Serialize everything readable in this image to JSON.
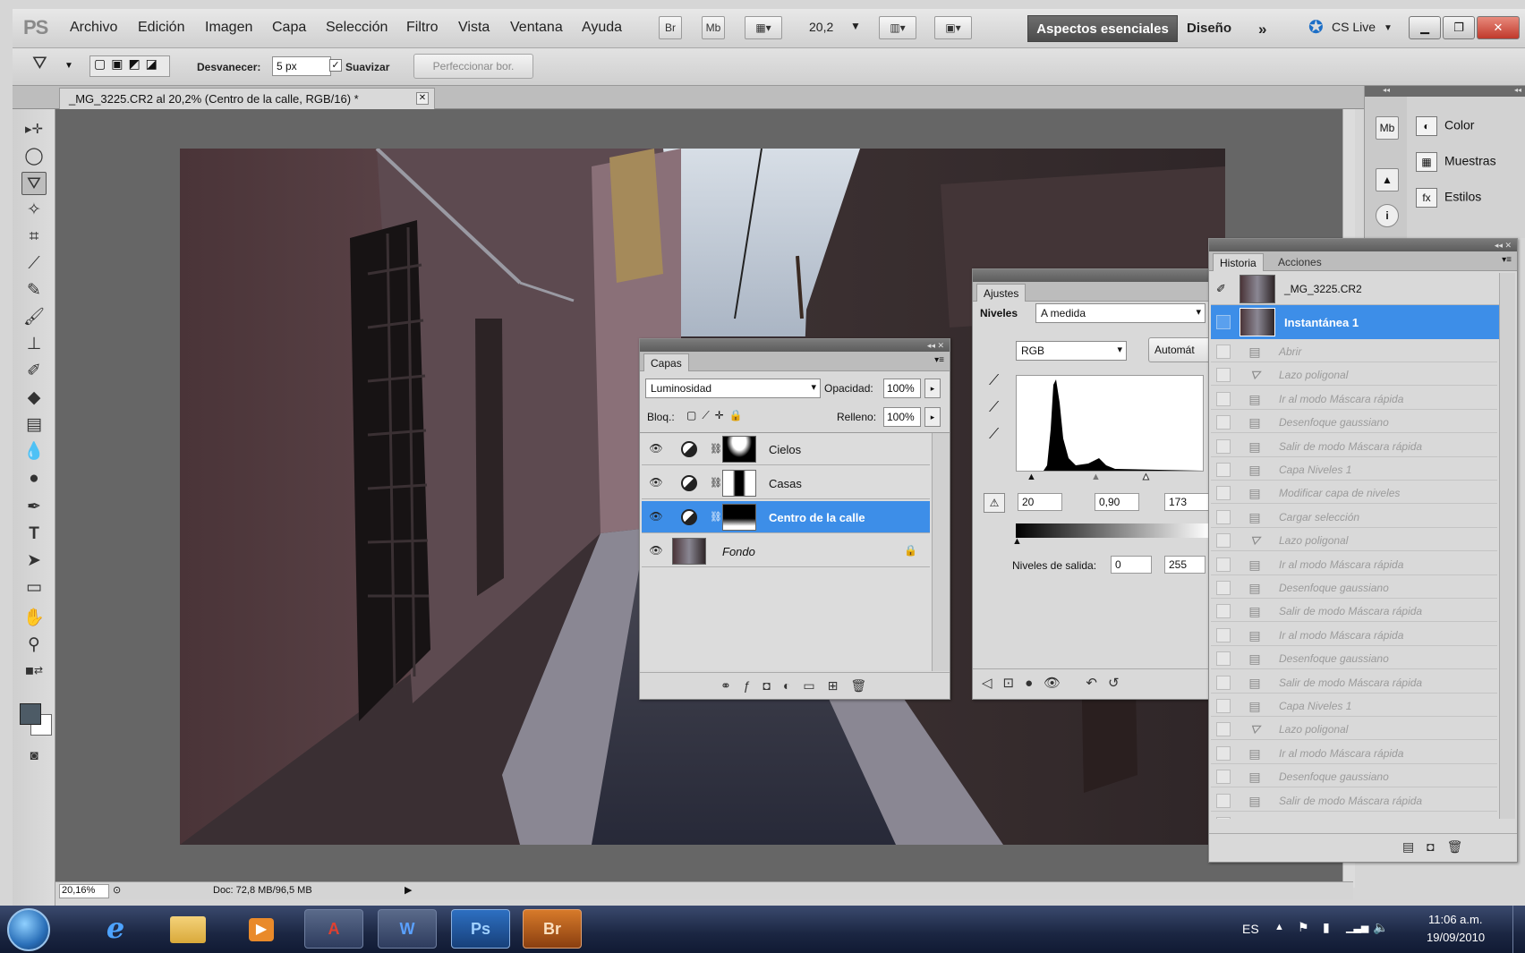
{
  "menu": {
    "logo": "PS",
    "items": [
      "Archivo",
      "Edición",
      "Imagen",
      "Capa",
      "Selección",
      "Filtro",
      "Vista",
      "Ventana",
      "Ayuda"
    ],
    "zoom_select": "20,2",
    "workspace_active": "Aspectos esenciales",
    "workspace_design": "Diseño",
    "cslive": "CS Live"
  },
  "options": {
    "feather_label": "Desvanecer:",
    "feather_value": "5 px",
    "smooth_label": "Suavizar",
    "refine_button": "Perfeccionar bor."
  },
  "document": {
    "tab_title": "_MG_3225.CR2 al 20,2% (Centro de la calle, RGB/16) *",
    "status_zoom": "20,16%",
    "status_doc": "Doc: 72,8 MB/96,5 MB"
  },
  "dock": {
    "items": [
      "Color",
      "Muestras",
      "Estilos"
    ]
  },
  "layers_panel": {
    "tab": "Capas",
    "blend_mode": "Luminosidad",
    "opacity_label": "Opacidad:",
    "opacity_value": "100%",
    "lock_label": "Bloq.:",
    "fill_label": "Relleno:",
    "fill_value": "100%",
    "layers": [
      {
        "name": "Cielos"
      },
      {
        "name": "Casas"
      },
      {
        "name": "Centro de la calle"
      },
      {
        "name": "Fondo"
      }
    ]
  },
  "adjustments_panel": {
    "tab": "Ajustes",
    "type_label": "Niveles",
    "preset": "A medida",
    "channel": "RGB",
    "auto_button": "Automát",
    "input_black": "20",
    "input_gamma": "0,90",
    "input_white": "173",
    "output_label": "Niveles de salida:",
    "output_black": "0",
    "output_white": "255"
  },
  "history_panel": {
    "tabs": [
      "Historia",
      "Acciones"
    ],
    "source": "_MG_3225.CR2",
    "snapshot": "Instantánea 1",
    "steps": [
      {
        "label": "Abrir",
        "icon": "doc"
      },
      {
        "label": "Lazo poligonal",
        "icon": "lasso"
      },
      {
        "label": "Ir al modo Máscara rápida",
        "icon": "doc"
      },
      {
        "label": "Desenfoque gaussiano",
        "icon": "doc"
      },
      {
        "label": "Salir de modo Máscara rápida",
        "icon": "doc"
      },
      {
        "label": "Capa Niveles 1",
        "icon": "doc"
      },
      {
        "label": "Modificar capa de niveles",
        "icon": "doc"
      },
      {
        "label": "Cargar selección",
        "icon": "doc"
      },
      {
        "label": "Lazo poligonal",
        "icon": "lasso"
      },
      {
        "label": "Ir al modo Máscara rápida",
        "icon": "doc"
      },
      {
        "label": "Desenfoque gaussiano",
        "icon": "doc"
      },
      {
        "label": "Salir de modo Máscara rápida",
        "icon": "doc"
      },
      {
        "label": "Ir al modo Máscara rápida",
        "icon": "doc"
      },
      {
        "label": "Desenfoque gaussiano",
        "icon": "doc"
      },
      {
        "label": "Salir de modo Máscara rápida",
        "icon": "doc"
      },
      {
        "label": "Capa Niveles 1",
        "icon": "doc"
      },
      {
        "label": "Lazo poligonal",
        "icon": "lasso"
      },
      {
        "label": "Ir al modo Máscara rápida",
        "icon": "doc"
      },
      {
        "label": "Desenfoque gaussiano",
        "icon": "doc"
      },
      {
        "label": "Salir de modo Máscara rápida",
        "icon": "doc"
      },
      {
        "label": "Ir al modo Máscara rápida",
        "icon": "doc"
      }
    ]
  },
  "taskbar": {
    "apps": [
      "Ps",
      "Br"
    ],
    "language": "ES",
    "time": "11:06 a.m.",
    "date": "19/09/2010"
  },
  "colors": {
    "accent": "#3d8ee8",
    "workspace_active_bg": "#555555"
  }
}
